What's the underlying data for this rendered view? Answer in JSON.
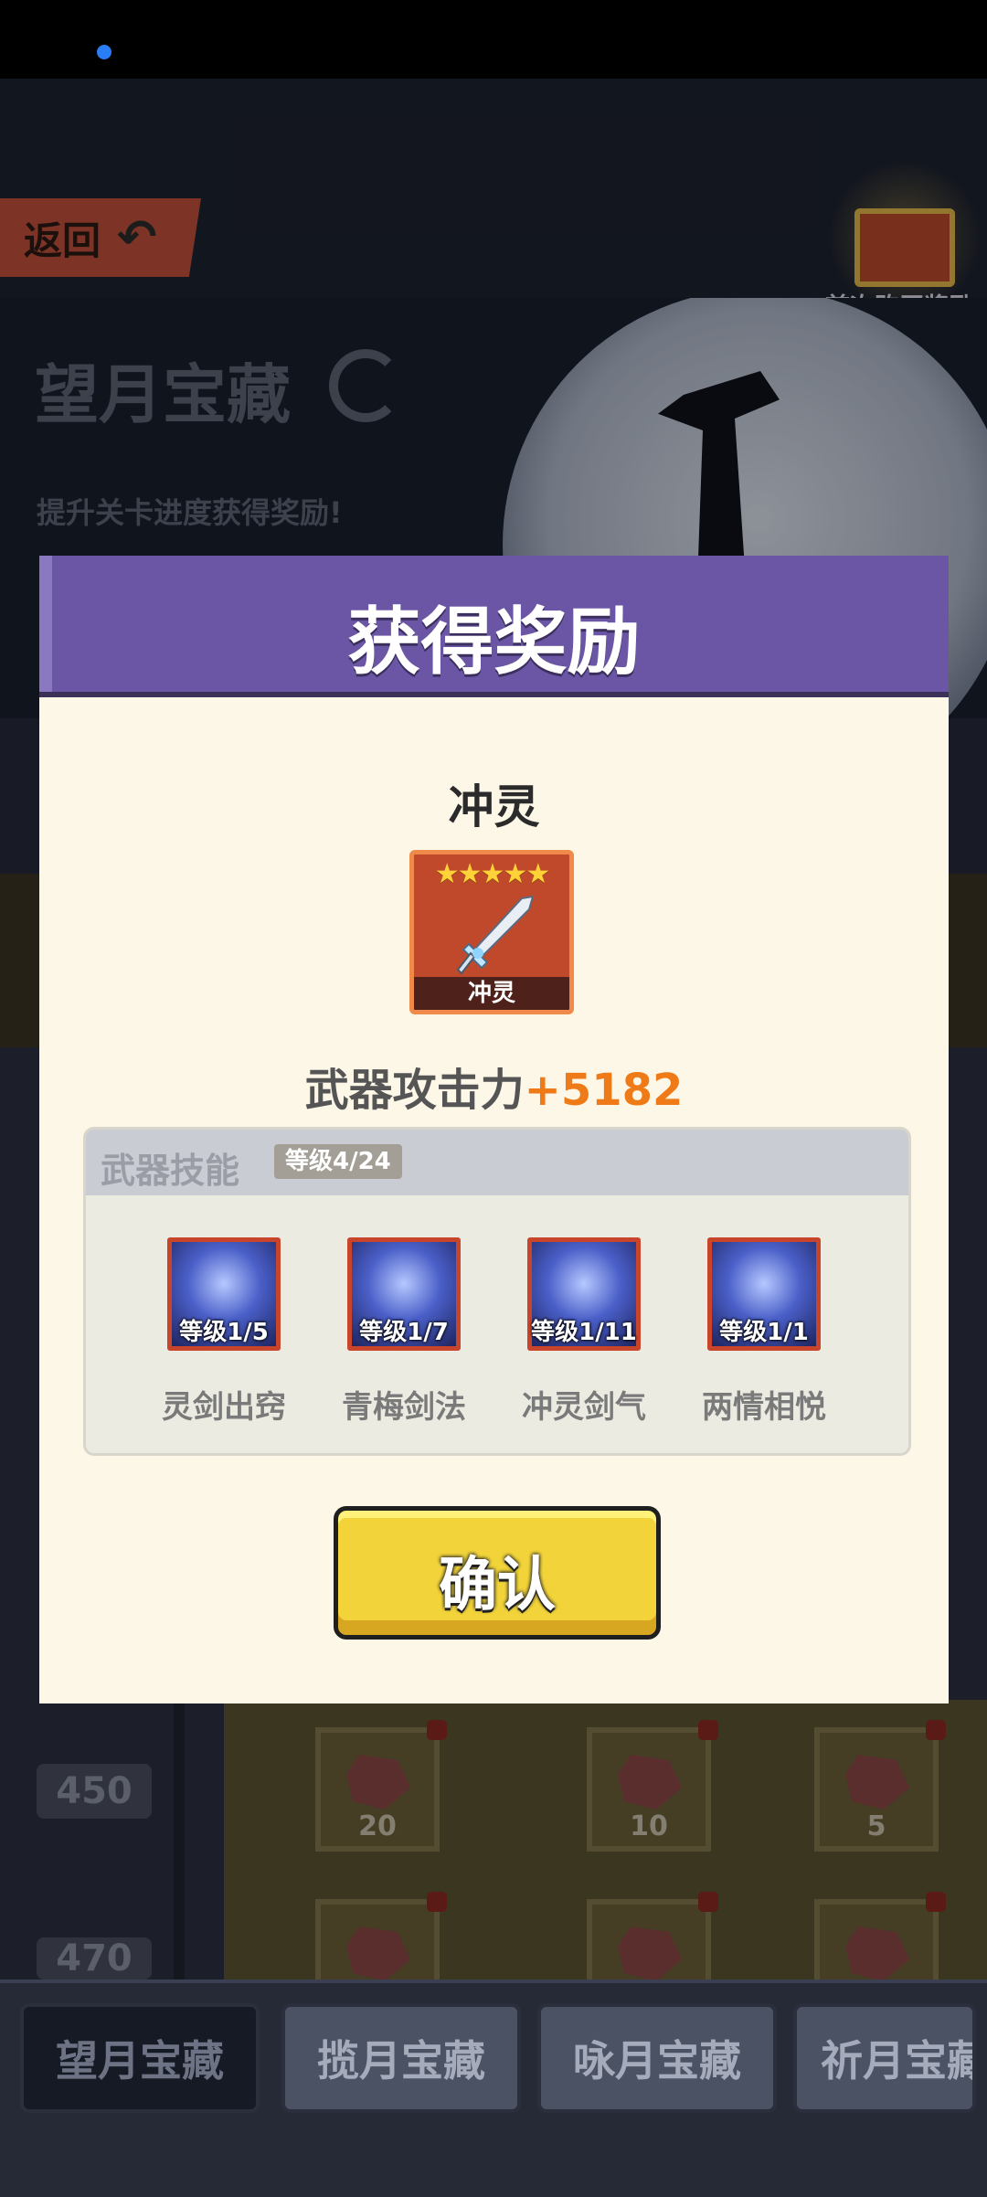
{
  "background": {
    "back_label": "返回",
    "first_purchase_label": "首次购买奖励",
    "banner_title": "望月宝藏",
    "banner_subtitle": "提升关卡进度获得奖励!",
    "list_rows": [
      {
        "level": "450",
        "rewards": [
          "20",
          "10",
          "5"
        ]
      },
      {
        "level": "470"
      }
    ]
  },
  "modal": {
    "title": "获得奖励",
    "item_name": "冲灵",
    "item_card_label": "冲灵",
    "stars": "★★★★★",
    "attack_label": "武器攻击力",
    "attack_bonus": "+5182",
    "skills_title": "武器技能",
    "skills_level": "等级4/24",
    "skills": [
      {
        "level": "等级1/5",
        "name": "灵剑出窍"
      },
      {
        "level": "等级1/7",
        "name": "青梅剑法"
      },
      {
        "level": "等级1/11",
        "name": "冲灵剑气"
      },
      {
        "level": "等级1/1",
        "name": "两情相悦"
      }
    ],
    "confirm_label": "确认"
  },
  "tabs": [
    {
      "label": "望月宝藏",
      "active": true
    },
    {
      "label": "揽月宝藏",
      "active": false
    },
    {
      "label": "咏月宝藏",
      "active": false
    },
    {
      "label": "祈月宝藏",
      "active": false
    }
  ],
  "colors": {
    "modal_header": "#6a56a4",
    "attack_bonus": "#ef7a18",
    "confirm_button": "#f2d43a"
  }
}
